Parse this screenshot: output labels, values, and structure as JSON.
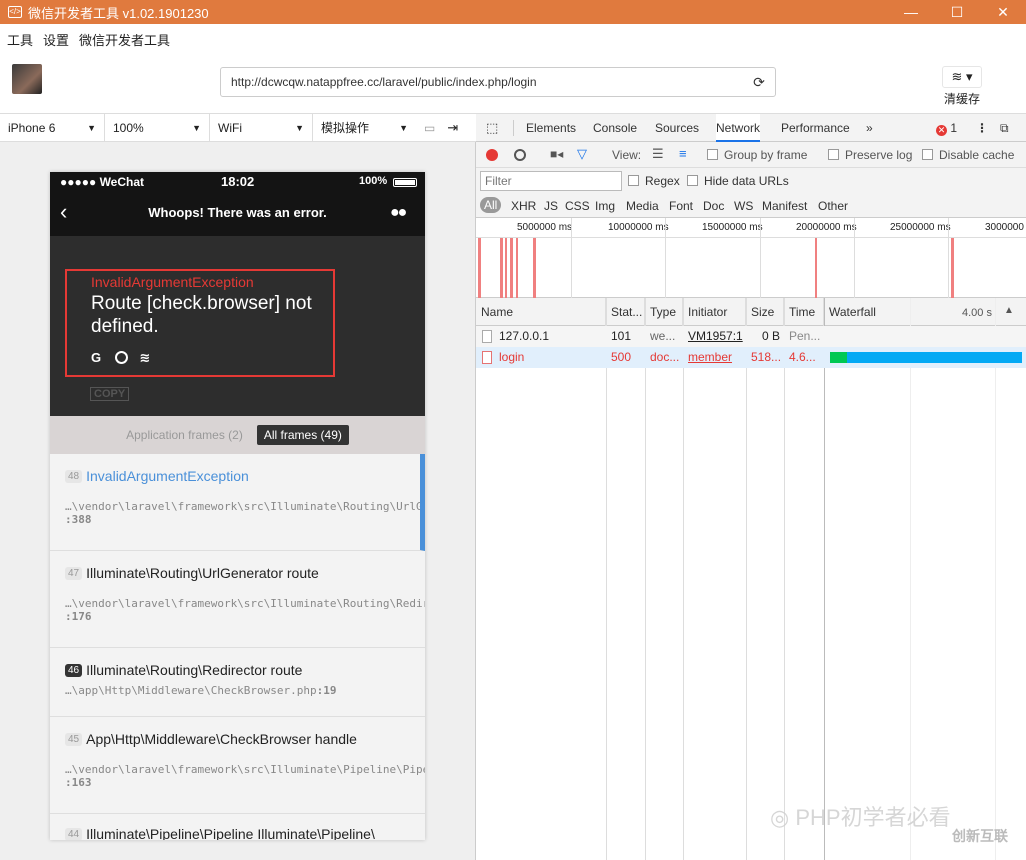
{
  "window": {
    "title": "微信开发者工具 v1.02.1901230",
    "controls": [
      "—",
      "☐",
      "✕"
    ]
  },
  "menu": [
    "工具",
    "设置",
    "微信开发者工具"
  ],
  "address": {
    "url": "http://dcwcqw.natappfree.cc/laravel/public/index.php/login",
    "clear_cache": "清缓存"
  },
  "device_bar": {
    "device": "iPhone 6",
    "zoom": "100%",
    "network": "WiFi",
    "action": "模拟操作"
  },
  "phone": {
    "carrier": "●●●●● WeChat",
    "time": "18:02",
    "battery": "100%",
    "nav_title": "Whoops! There was an error.",
    "exception_class": "InvalidArgumentException",
    "exception_message": "Route [check.browser] not defined.",
    "copy_label": "COPY",
    "tab_app_frames": "Application frames (2)",
    "tab_all_frames": "All frames (49)",
    "frames": [
      {
        "num": "48",
        "title": "InvalidArgumentException",
        "path": "…\\vendor\\laravel\\framework\\src\\Illuminate\\Routing\\UrlGenerator.php",
        "line": ":388"
      },
      {
        "num": "47",
        "title": "Illuminate\\Routing\\UrlGenerator route",
        "path": "…\\vendor\\laravel\\framework\\src\\Illuminate\\Routing\\Redirector.php",
        "line": ":176"
      },
      {
        "num": "46",
        "title": "Illuminate\\Routing\\Redirector route",
        "path": "…\\app\\Http\\Middleware\\CheckBrowser.php",
        "line": ":19"
      },
      {
        "num": "45",
        "title": "App\\Http\\Middleware\\CheckBrowser handle",
        "path": "…\\vendor\\laravel\\framework\\src\\Illuminate\\Pipeline\\Pipeline.php",
        "line": ":163"
      },
      {
        "num": "44",
        "title": "Illuminate\\Pipeline\\Pipeline Illuminate\\Pipeline\\"
      }
    ]
  },
  "devtools": {
    "tabs": [
      "Elements",
      "Console",
      "Sources",
      "Network",
      "Performance",
      "»"
    ],
    "active_tab": "Network",
    "error_count": "1",
    "toolbar": {
      "view_label": "View:",
      "group_by_frame": "Group by frame",
      "preserve_log": "Preserve log",
      "disable_cache": "Disable cache"
    },
    "filter": {
      "placeholder": "Filter",
      "regex": "Regex",
      "hide_data_urls": "Hide data URLs"
    },
    "types": [
      "All",
      "XHR",
      "JS",
      "CSS",
      "Img",
      "Media",
      "Font",
      "Doc",
      "WS",
      "Manifest",
      "Other"
    ],
    "timeline_ticks": [
      "5000000 ms",
      "10000000 ms",
      "15000000 ms",
      "20000000 ms",
      "25000000 ms",
      "3000000"
    ],
    "columns": [
      "Name",
      "Stat...",
      "Type",
      "Initiator",
      "Size",
      "Time",
      "Waterfall"
    ],
    "waterfall_scale": "4.00 s",
    "rows": [
      {
        "name": "127.0.0.1",
        "status": "101",
        "type": "we...",
        "initiator": "VM1957:1",
        "size": "0 B",
        "time": "Pen...",
        "error": false
      },
      {
        "name": "login",
        "status": "500",
        "type": "doc...",
        "initiator": "member",
        "size": "518...",
        "time": "4.6...",
        "error": true
      }
    ],
    "login_waterfall": {
      "waiting_fraction": 0.09,
      "download_fraction": 0.91
    }
  },
  "watermark": {
    "text": "PHP初学者必看",
    "brand": "创新互联"
  },
  "colors": {
    "titlebar": "#e07a3e",
    "error_red": "#e53935",
    "wf_wait": "#00c853",
    "wf_download": "#03a9f4",
    "frame_link": "#4a90d9"
  }
}
